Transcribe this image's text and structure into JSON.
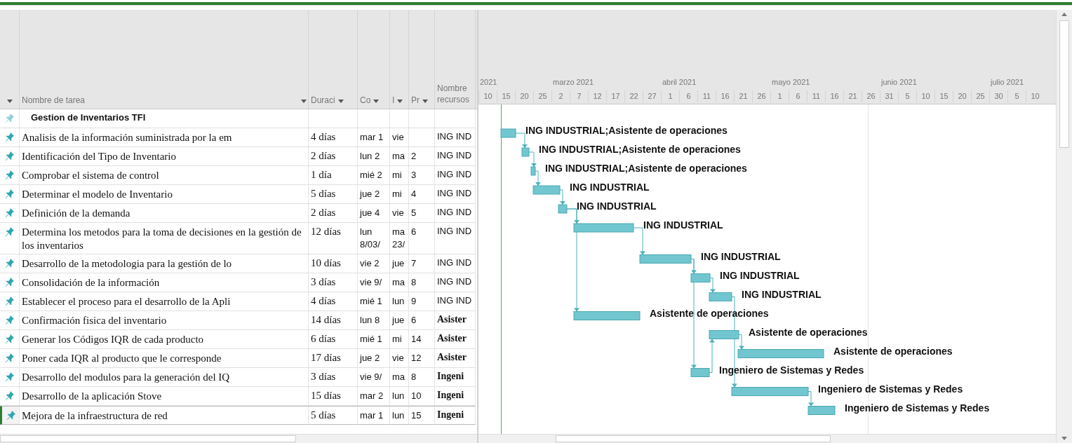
{
  "columns": [
    {
      "label": "Nombre de tarea"
    },
    {
      "label": "Duraci"
    },
    {
      "label": "Co"
    },
    {
      "label": "I"
    },
    {
      "label": "Pr"
    },
    {
      "label": "Nombre recursos"
    }
  ],
  "timescale": [
    {
      "label": "2021",
      "days": [
        "10",
        "15",
        "20",
        "25"
      ]
    },
    {
      "label": "marzo 2021",
      "days": [
        "2",
        "7",
        "12",
        "17",
        "22",
        "27"
      ]
    },
    {
      "label": "abril 2021",
      "days": [
        "1",
        "6",
        "11",
        "16",
        "21",
        "26"
      ]
    },
    {
      "label": "mayo 2021",
      "days": [
        "1",
        "6",
        "11",
        "16",
        "21",
        "26"
      ]
    },
    {
      "label": "junio 2021",
      "days": [
        "31",
        "5",
        "10",
        "15",
        "20",
        "25"
      ]
    },
    {
      "label": "julio 2021",
      "days": [
        "30",
        "5",
        "10"
      ]
    }
  ],
  "summary": {
    "name": "Gestion de Inventarios TFI"
  },
  "tasks": [
    {
      "name": "Analisis de la información suministrada por la em",
      "duration": "4 días",
      "start": "mar 1",
      "finish": "vie",
      "resources": "ING IND",
      "resource_bold": false,
      "bar_label": "ING INDUSTRIAL;Asistente de operaciones",
      "selected": false
    },
    {
      "name": "Identificación del Tipo de Inventario",
      "duration": "2 días",
      "start": "lun 2",
      "finish": "ma",
      "predecessors": "2",
      "resources": "ING IND",
      "resource_bold": false,
      "bar_label": "ING INDUSTRIAL;Asistente de operaciones",
      "selected": false
    },
    {
      "name": "Comprobar el sistema de control",
      "duration": "1 día",
      "start": "mié 2",
      "finish": "mi",
      "predecessors": "3",
      "resources": "ING IND",
      "resource_bold": false,
      "bar_label": "ING INDUSTRIAL;Asistente de operaciones",
      "selected": false
    },
    {
      "name": "Determinar el modelo de Inventario",
      "duration": "5 días",
      "start": "jue 2",
      "finish": "mi",
      "predecessors": "4",
      "resources": "ING IND",
      "resource_bold": false,
      "bar_label": "ING INDUSTRIAL",
      "selected": false
    },
    {
      "name": "Definición de la demanda",
      "duration": "2 días",
      "start": "jue 4",
      "finish": "vie",
      "predecessors": "5",
      "resources": "ING IND",
      "resource_bold": false,
      "bar_label": "ING INDUSTRIAL",
      "selected": false
    },
    {
      "name": "Determina los metodos para la toma de decisiones en la gestión de los inventarios",
      "duration": "12 días",
      "start": "lun 8/03/",
      "finish": "ma 23/",
      "predecessors": "6",
      "resources": "ING IND",
      "resource_bold": false,
      "bar_label": "ING INDUSTRIAL",
      "selected": false
    },
    {
      "name": "Desarrollo de la metodologia para la gestión de lo",
      "duration": "10 días",
      "start": "vie 2",
      "finish": "jue",
      "predecessors": "7",
      "resources": "ING IND",
      "resource_bold": false,
      "bar_label": "ING INDUSTRIAL",
      "selected": false
    },
    {
      "name": "Consolidación de la información",
      "duration": "3 días",
      "start": "vie 9/",
      "finish": "ma",
      "predecessors": "8",
      "resources": "ING IND",
      "resource_bold": false,
      "bar_label": "ING INDUSTRIAL",
      "selected": false
    },
    {
      "name": "Establecer el proceso para el desarrollo de la Apli",
      "duration": "4 días",
      "start": "mié 1",
      "finish": "lun",
      "predecessors": "9",
      "resources": "ING IND",
      "resource_bold": false,
      "bar_label": "ING INDUSTRIAL",
      "selected": false
    },
    {
      "name": "Confirmación fisica del inventario",
      "duration": "14 días",
      "start": "lun 8",
      "finish": "jue",
      "predecessors": "6",
      "resources": "Asister",
      "resource_bold": true,
      "bar_label": "Asistente de operaciones",
      "selected": false
    },
    {
      "name": "Generar los Códigos IQR de cada producto",
      "duration": "6 días",
      "start": "mié 1",
      "finish": "mi",
      "predecessors": "14",
      "resources": "Asister",
      "resource_bold": true,
      "bar_label": "Asistente de operaciones",
      "selected": false
    },
    {
      "name": "Poner cada IQR al producto que le corresponde",
      "duration": "17 días",
      "start": "jue 2",
      "finish": "vie",
      "predecessors": "12",
      "resources": "Asister",
      "resource_bold": true,
      "bar_label": "Asistente de operaciones",
      "selected": false
    },
    {
      "name": "Desarrollo del modulos para la generación del IQ",
      "duration": "3 días",
      "start": "vie 9/",
      "finish": "ma",
      "predecessors": "8",
      "resources": "Ingeni",
      "resource_bold": true,
      "bar_label": "Ingeniero de Sistemas y Redes",
      "selected": false
    },
    {
      "name": "Desarrollo de la aplicación Stove",
      "duration": "15 días",
      "start": "mar 2",
      "finish": "lun",
      "predecessors": "10",
      "resources": "Ingeni",
      "resource_bold": true,
      "bar_label": "Ingeniero de Sistemas y Redes",
      "selected": false
    },
    {
      "name": "Mejora de la infraestructura de red",
      "duration": "5 días",
      "start": "mar 1",
      "finish": "lun",
      "predecessors": "15",
      "resources": "Ingeni",
      "resource_bold": true,
      "bar_label": "Ingeniero de Sistemas y Redes",
      "selected": true
    }
  ]
}
